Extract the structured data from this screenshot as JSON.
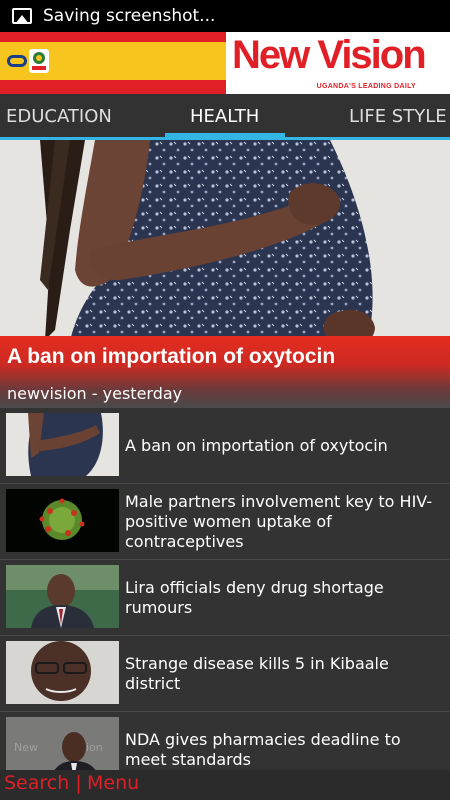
{
  "status_bar": {
    "text": "Saving screenshot..."
  },
  "header": {
    "brand": "New Vision",
    "tagline": "UGANDA'S LEADING DAILY"
  },
  "tabs": [
    {
      "label": "EDUCATION"
    },
    {
      "label": "HEALTH",
      "active": true
    },
    {
      "label": "LIFE STYLE"
    }
  ],
  "hero": {
    "title": "A ban on importation of oxytocin",
    "meta": "newvision - yesterday"
  },
  "articles": [
    {
      "title": "A ban on importation of oxytocin"
    },
    {
      "title": "Male partners involvement key to HIV-positive women uptake of contraceptives"
    },
    {
      "title": "Lira officials deny drug shortage rumours"
    },
    {
      "title": "Strange disease kills 5 in Kibaale district"
    },
    {
      "title": "NDA gives pharmacies deadline to meet standards"
    }
  ],
  "bottom_bar": {
    "search": "Search |",
    "menu": "Menu"
  },
  "colors": {
    "brand_red": "#e01f26",
    "tab_accent": "#33b5e5",
    "banner_yellow": "#f7c51e"
  }
}
